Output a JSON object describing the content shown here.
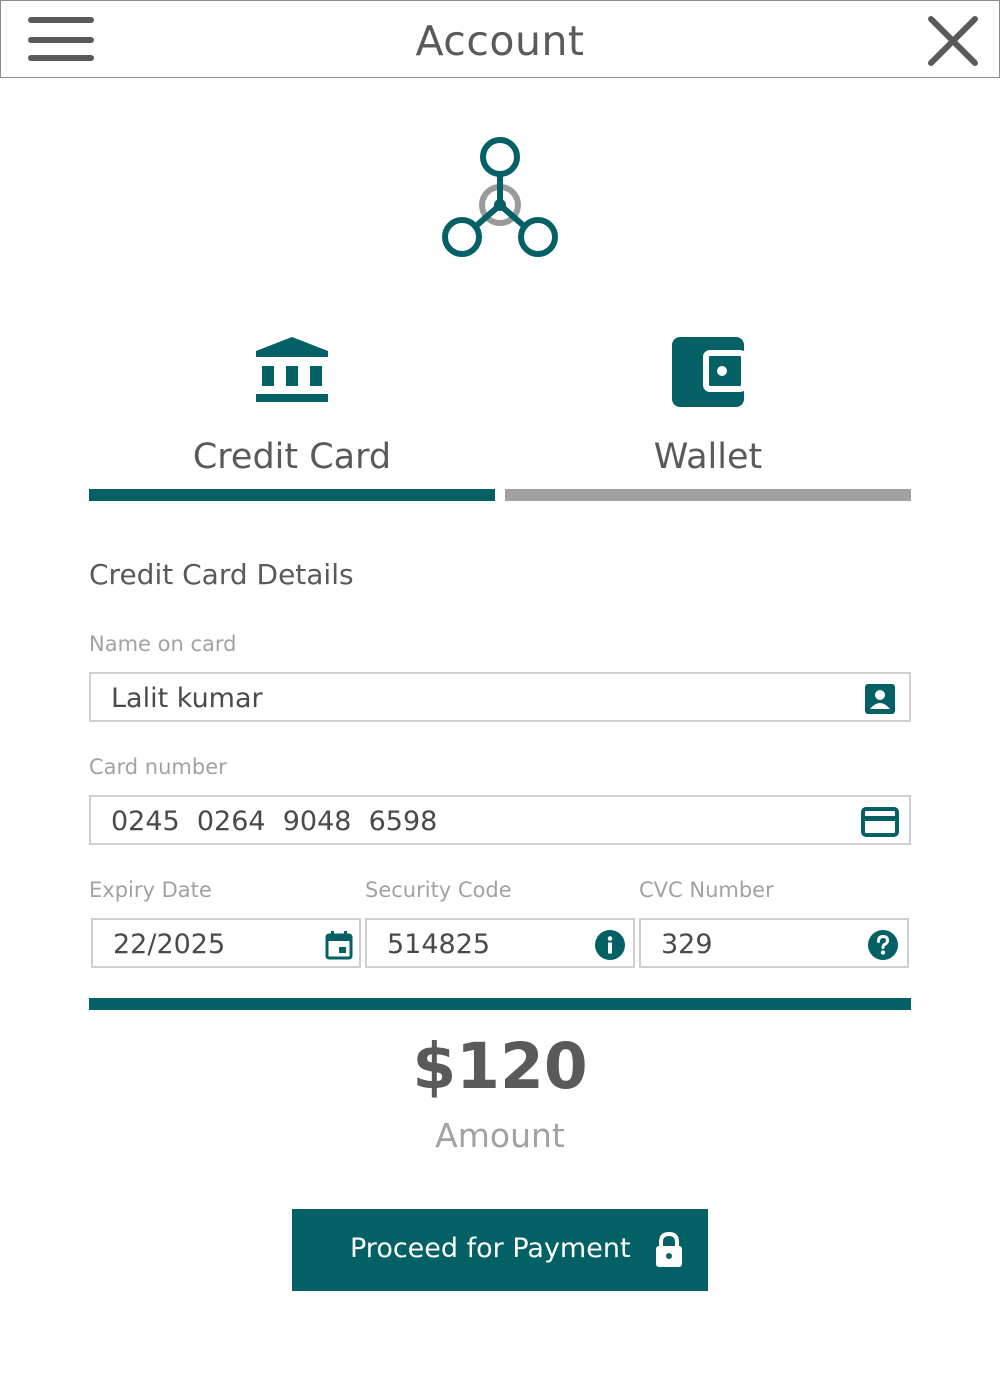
{
  "header": {
    "title": "Account",
    "menu_icon": "hamburger-menu-icon",
    "close_icon": "close-icon"
  },
  "logo": {
    "icon": "share-network-icon"
  },
  "tabs": [
    {
      "label": "Credit Card",
      "icon": "bank-icon",
      "active": true
    },
    {
      "label": "Wallet",
      "icon": "wallet-icon",
      "active": false
    }
  ],
  "form": {
    "section_title": "Credit Card Details",
    "name": {
      "label": "Name on card",
      "value": "Lalit kumar",
      "icon": "contact-card-icon"
    },
    "card_number": {
      "label": "Card number",
      "value": "0245  0264  9048  6598",
      "icon": "credit-card-icon"
    },
    "expiry": {
      "label": "Expiry Date",
      "value": "22/2025",
      "icon": "calendar-icon"
    },
    "security": {
      "label": "Security Code",
      "value": "514825",
      "icon": "info-icon"
    },
    "cvc": {
      "label": "CVC Number",
      "value": "329",
      "icon": "help-icon"
    }
  },
  "amount": {
    "value": "$120",
    "label": "Amount"
  },
  "pay_button": {
    "label": "Proceed for Payment",
    "icon": "lock-icon"
  },
  "colors": {
    "accent": "#036165",
    "inactive_tab": "#a0a0a0",
    "text": "#5a5a5a",
    "muted_text": "#a2a2a2",
    "border": "#cfcfcf"
  }
}
